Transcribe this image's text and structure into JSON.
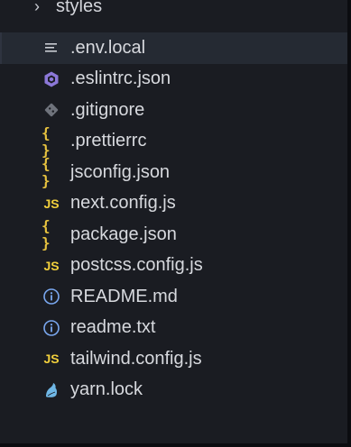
{
  "explorer": {
    "folder": {
      "label": "styles",
      "icon": "chevron-right-icon"
    },
    "files": [
      {
        "label": ".env.local",
        "icon": "lines-icon",
        "selected": true
      },
      {
        "label": ".eslintrc.json",
        "icon": "eslint-icon"
      },
      {
        "label": ".gitignore",
        "icon": "git-icon"
      },
      {
        "label": ".prettierrc",
        "icon": "json-braces-icon"
      },
      {
        "label": "jsconfig.json",
        "icon": "json-braces-icon"
      },
      {
        "label": "next.config.js",
        "icon": "javascript-icon"
      },
      {
        "label": "package.json",
        "icon": "json-braces-icon"
      },
      {
        "label": "postcss.config.js",
        "icon": "javascript-icon"
      },
      {
        "label": "README.md",
        "icon": "info-icon"
      },
      {
        "label": "readme.txt",
        "icon": "info-icon"
      },
      {
        "label": "tailwind.config.js",
        "icon": "javascript-icon"
      },
      {
        "label": "yarn.lock",
        "icon": "yarn-icon"
      }
    ],
    "icon_glyphs": {
      "braces": "{ }",
      "js": "JS"
    },
    "colors": {
      "background": "#1a1c22",
      "selected_row": "#252a33",
      "text": "#d7d9de",
      "json_yellow": "#e8c33f",
      "js_yellow": "#f1cf3c",
      "eslint_purple": "#8c78d8",
      "git_gray": "#6f737c",
      "info_blue": "#7aa8f0",
      "yarn_blue": "#6fb7e6"
    }
  }
}
